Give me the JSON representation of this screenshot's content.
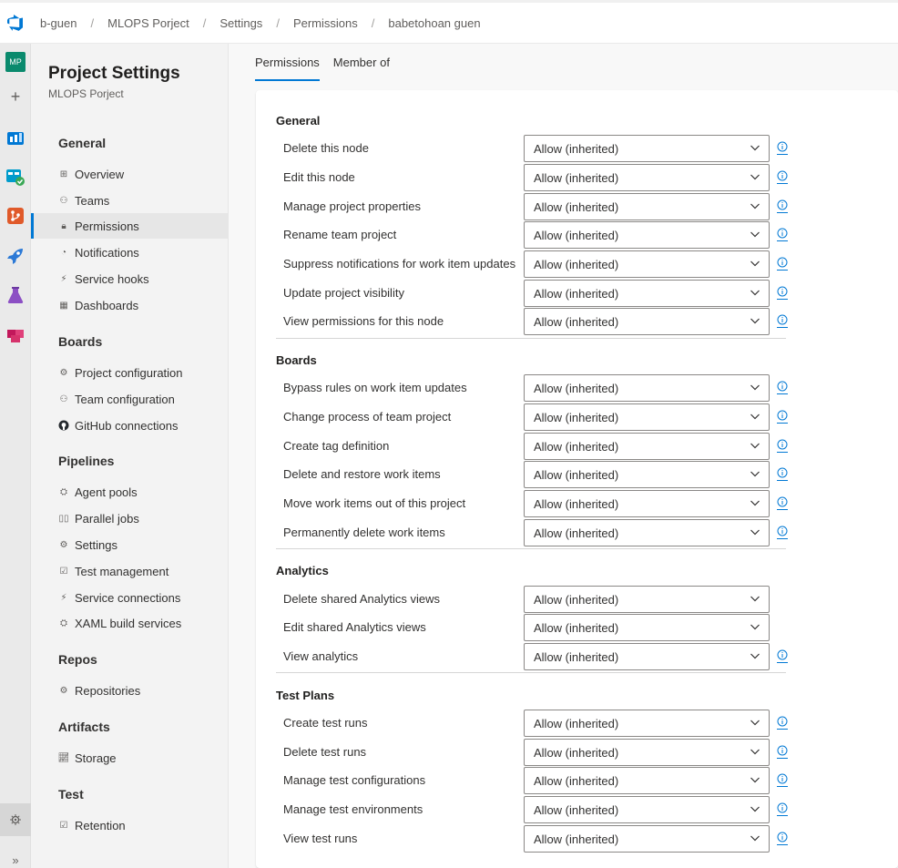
{
  "breadcrumb": [
    "b-guen",
    "MLOPS Porject",
    "Settings",
    "Permissions",
    "babetohoan guen"
  ],
  "rail": {
    "avatar_initials": "MP",
    "items": [
      "boards-icon",
      "test-plans-flask-icon",
      "artifacts-icon",
      "repos-icon",
      "pipelines-icon",
      "overview-icon"
    ]
  },
  "sidenav": {
    "title": "Project Settings",
    "subtitle": "MLOPS Porject",
    "groups": {
      "general": {
        "heading": "General",
        "items": [
          "Overview",
          "Teams",
          "Permissions",
          "Notifications",
          "Service hooks",
          "Dashboards"
        ]
      },
      "boards": {
        "heading": "Boards",
        "items": [
          "Project configuration",
          "Team configuration",
          "GitHub connections"
        ]
      },
      "pipelines": {
        "heading": "Pipelines",
        "items": [
          "Agent pools",
          "Parallel jobs",
          "Settings",
          "Test management",
          "Service connections",
          "XAML build services"
        ]
      },
      "repos": {
        "heading": "Repos",
        "items": [
          "Repositories"
        ]
      },
      "artifacts": {
        "heading": "Artifacts",
        "items": [
          "Storage"
        ]
      },
      "test": {
        "heading": "Test",
        "items": [
          "Retention"
        ]
      }
    },
    "active_item": "Permissions"
  },
  "tabs": [
    "Permissions",
    "Member of"
  ],
  "active_tab": "Permissions",
  "sections": {
    "general": {
      "title": "General",
      "rows": [
        {
          "label": "Delete this node",
          "value": "Allow (inherited)"
        },
        {
          "label": "Edit this node",
          "value": "Allow (inherited)"
        },
        {
          "label": "Manage project properties",
          "value": "Allow (inherited)"
        },
        {
          "label": "Rename team project",
          "value": "Allow (inherited)"
        },
        {
          "label": "Suppress notifications for work item updates",
          "value": "Allow (inherited)"
        },
        {
          "label": "Update project visibility",
          "value": "Allow (inherited)"
        },
        {
          "label": "View permissions for this node",
          "value": "Allow (inherited)"
        }
      ]
    },
    "boards": {
      "title": "Boards",
      "rows": [
        {
          "label": "Bypass rules on work item updates",
          "value": "Allow (inherited)"
        },
        {
          "label": "Change process of team project",
          "value": "Allow (inherited)"
        },
        {
          "label": "Create tag definition",
          "value": "Allow (inherited)"
        },
        {
          "label": "Delete and restore work items",
          "value": "Allow (inherited)"
        },
        {
          "label": "Move work items out of this project",
          "value": "Allow (inherited)"
        },
        {
          "label": "Permanently delete work items",
          "value": "Allow (inherited)"
        }
      ]
    },
    "analytics": {
      "title": "Analytics",
      "rows": [
        {
          "label": "Delete shared Analytics views",
          "value": "Allow (inherited)"
        },
        {
          "label": "Edit shared Analytics views",
          "value": "Allow (inherited)"
        },
        {
          "label": "View analytics",
          "value": "Allow (inherited)"
        }
      ]
    },
    "test_plans": {
      "title": "Test Plans",
      "rows": [
        {
          "label": "Create test runs",
          "value": "Allow (inherited)"
        },
        {
          "label": "Delete test runs",
          "value": "Allow (inherited)"
        },
        {
          "label": "Manage test configurations",
          "value": "Allow (inherited)"
        },
        {
          "label": "Manage test environments",
          "value": "Allow (inherited)"
        },
        {
          "label": "View test runs",
          "value": "Allow (inherited)"
        }
      ]
    }
  },
  "colors": {
    "accent": "#0078d4",
    "avatar_bg": "#0a8a6d"
  }
}
